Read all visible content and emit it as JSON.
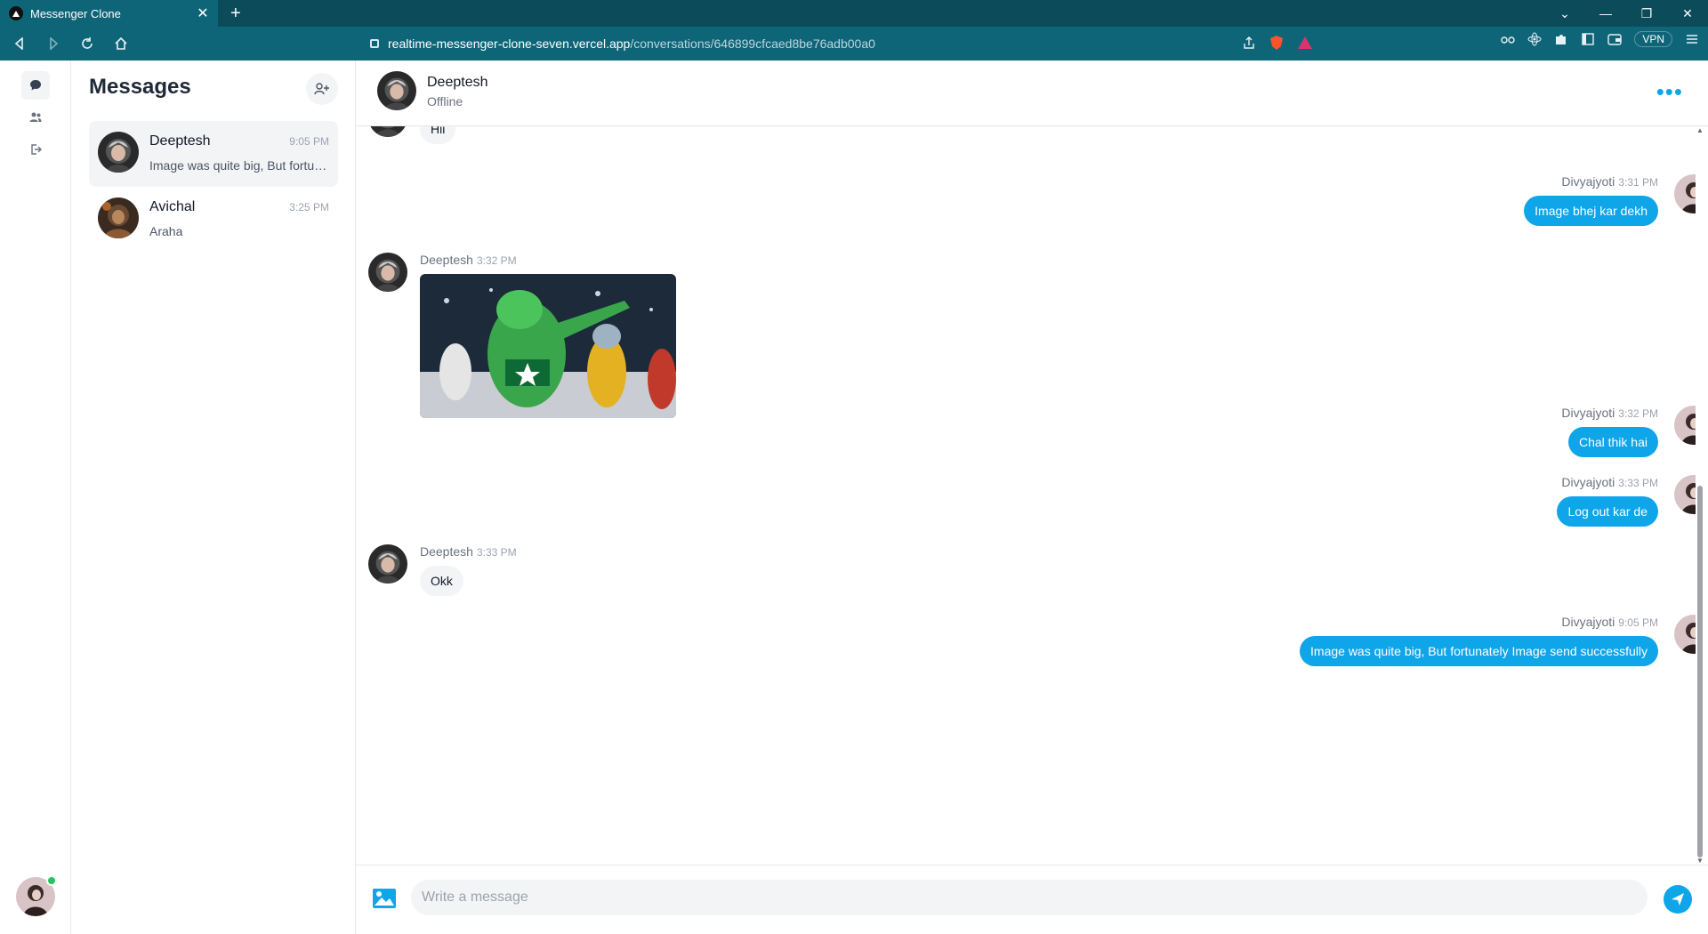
{
  "browser": {
    "tab_title": "Messenger Clone",
    "url_host": "realtime-messenger-clone-seven.vercel.app",
    "url_path": "/conversations/646899cfcaed8be76adb00a0",
    "vpn_label": "VPN"
  },
  "sidebar": {
    "title": "Messages",
    "conversations": [
      {
        "name": "Deeptesh",
        "time": "9:05 PM",
        "last_message": "Image was quite big, But fortunately Image send successfully"
      },
      {
        "name": "Avichal",
        "time": "3:25 PM",
        "last_message": "Araha"
      }
    ]
  },
  "chat": {
    "name": "Deeptesh",
    "status": "Offline",
    "messages": [
      {
        "sender": "Deeptesh",
        "time": "",
        "text": "Hii",
        "kind": "in"
      },
      {
        "sender": "Divyajyoti",
        "time": "3:31 PM",
        "text": "Image bhej kar dekh",
        "kind": "out"
      },
      {
        "sender": "Deeptesh",
        "time": "3:32 PM",
        "text": "",
        "kind": "image"
      },
      {
        "sender": "Divyajyoti",
        "time": "3:32 PM",
        "text": "Chal thik hai",
        "kind": "out"
      },
      {
        "sender": "Divyajyoti",
        "time": "3:33 PM",
        "text": "Log out kar de",
        "kind": "out"
      },
      {
        "sender": "Deeptesh",
        "time": "3:33 PM",
        "text": "Okk",
        "kind": "in"
      },
      {
        "sender": "Divyajyoti",
        "time": "9:05 PM",
        "text": "Image was quite big, But fortunately Image send successfully",
        "kind": "out"
      }
    ]
  },
  "composer": {
    "placeholder": "Write a message"
  },
  "colors": {
    "accent": "#0ea5e9",
    "online": "#22c55e",
    "browser_bar": "#0f6578"
  }
}
